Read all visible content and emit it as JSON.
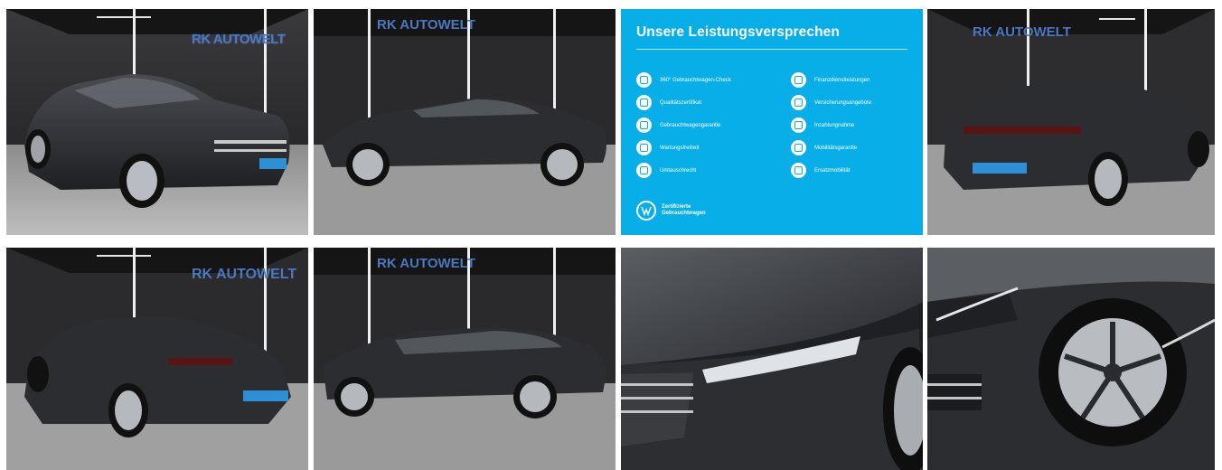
{
  "gallery": {
    "brand_sign": "RK AUTOWELT",
    "promise": {
      "title": "Unsere Leistungsversprechen",
      "items_left": [
        "360° Gebrauchtwagen-Check",
        "Qualitätszertifikat",
        "Gebrauchtwagengarantie",
        "Wartungsfreiheit",
        "Umtauschrecht"
      ],
      "items_right": [
        "Finanzdienstleistungen",
        "Versicherungsangebote",
        "Inzahlungnahme",
        "Mobilitätsgarantie",
        "Ersatzmobilität"
      ],
      "badge_line1": "Zertifizierte",
      "badge_line2": "Gebrauchtwagen"
    },
    "colors": {
      "promise_bg": "#08aee8",
      "car_body": "#2b2d31",
      "brand_sign": "#4c78c0"
    }
  }
}
